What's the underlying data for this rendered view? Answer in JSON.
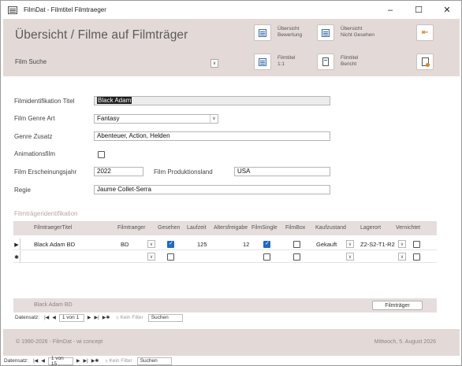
{
  "window": {
    "title": "FilmDat - Filmtitel Filmtraeger"
  },
  "header": {
    "title": "Übersicht / Filme auf Filmträger",
    "search_label": "Film Suche",
    "buttons": [
      {
        "label1": "Übersicht",
        "label2": "Bewertung",
        "icon": "table-doc-icon"
      },
      {
        "label1": "Übersicht",
        "label2": "Nicht Gesehen",
        "icon": "table-doc-icon"
      },
      {
        "label1": "Filmtitel",
        "label2": "1:1",
        "icon": "table-doc-icon"
      },
      {
        "label1": "Filmtitel",
        "label2": "Bericht",
        "icon": "report-icon"
      }
    ]
  },
  "form": {
    "id_label": "Filmidentifikation Titel",
    "id_value": "Black Adam",
    "genre_label": "Film Genre Art",
    "genre_value": "Fantasy",
    "genre_extra_label": "Genre Zusatz",
    "genre_extra_value": "Abenteuer, Action, Helden",
    "animation_label": "Animationsfilm",
    "animation_checked": false,
    "year_label": "Film Erscheinungsjahr",
    "year_value": "2022",
    "country_label": "Film Produktionsland",
    "country_value": "USA",
    "director_label": "Regie",
    "director_value": "Jaume Collet-Serra"
  },
  "subform": {
    "section_title": "Filmträgeridentifikation",
    "columns": [
      "FilmtraegerTitel",
      "Filmtraeger",
      "Gesehen",
      "Laufzeit",
      "Altersfreigabe",
      "FilmSingle",
      "FilmBox",
      "Kaufzustand",
      "Lagerort",
      "Vernichtet"
    ],
    "row": {
      "title": "Black Adam BD",
      "carrier": "BD",
      "seen": true,
      "runtime": "125",
      "age": "12",
      "single": true,
      "box": false,
      "condition": "Gekauft",
      "location": "Z2-S2-T1-R2",
      "destroyed": false
    },
    "footer_text": "Black Adam BD",
    "footer_button": "Filmträger",
    "nav": {
      "label": "Datensatz:",
      "record": "1 von 1",
      "filter": "Kein Filter",
      "search": "Suchen"
    }
  },
  "footer": {
    "left": "© 1990-2026 - FilmDat - wi concept",
    "right": "Mittwoch, 5. August 2026"
  },
  "main_nav": {
    "label": "Datensatz:",
    "record": "1 von 15",
    "filter": "Kein Filter",
    "search": "Suchen"
  },
  "colors": {
    "header_bg": "#e3dad8",
    "accent": "#1d6cc8",
    "exit_icon": "#d9822b"
  }
}
